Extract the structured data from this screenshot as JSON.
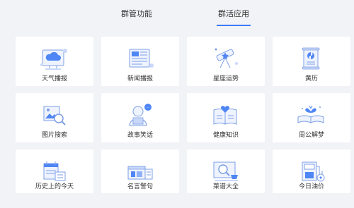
{
  "tabs": [
    {
      "label": "群管功能",
      "active": false
    },
    {
      "label": "群活应用",
      "active": true
    }
  ],
  "apps": [
    {
      "label": "天气播报",
      "icon": "weather-cloud-icon"
    },
    {
      "label": "新闻播报",
      "icon": "newspaper-icon"
    },
    {
      "label": "星座运势",
      "icon": "telescope-icon"
    },
    {
      "label": "黄历",
      "icon": "almanac-scroll-icon"
    },
    {
      "label": "图片搜索",
      "icon": "image-search-icon"
    },
    {
      "label": "故事笑话",
      "icon": "storyteller-icon"
    },
    {
      "label": "健康知识",
      "icon": "health-book-icon"
    },
    {
      "label": "周公解梦",
      "icon": "dream-book-icon"
    },
    {
      "label": "历史上的今天",
      "icon": "calendar-history-icon"
    },
    {
      "label": "名言警句",
      "icon": "quote-books-icon"
    },
    {
      "label": "菜谱大全",
      "icon": "recipe-search-icon"
    },
    {
      "label": "今日油价",
      "icon": "oil-price-icon"
    }
  ],
  "colors": {
    "accent": "#3d7bf7",
    "background": "#f2f3f6",
    "card": "#ffffff"
  }
}
